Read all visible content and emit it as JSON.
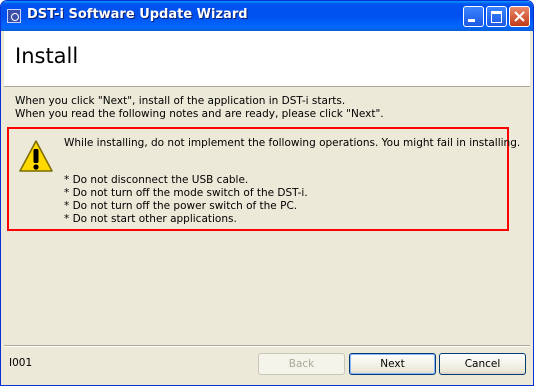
{
  "window": {
    "title": "DST-i Software Update Wizard",
    "titlebar_color": "#0050ee"
  },
  "header": {
    "title": "Install"
  },
  "intro": {
    "line1": "When you click \"Next\", install of the application in DST-i starts.",
    "line2": "When you read the following notes and are ready, please click \"Next\"."
  },
  "warning": {
    "border_color": "#ff0000",
    "icon": "warning-icon",
    "message": "While installing, do not implement the following operations. You might fail in installing.",
    "items": [
      "* Do not disconnect the USB cable.",
      "* Do not turn off the mode switch of the DST-i.",
      "* Do not turn off the power switch of the PC.",
      "* Do not start other applications."
    ]
  },
  "footer": {
    "page_id": "I001",
    "back_label": "Back",
    "back_enabled": false,
    "next_label": "Next",
    "cancel_label": "Cancel"
  }
}
